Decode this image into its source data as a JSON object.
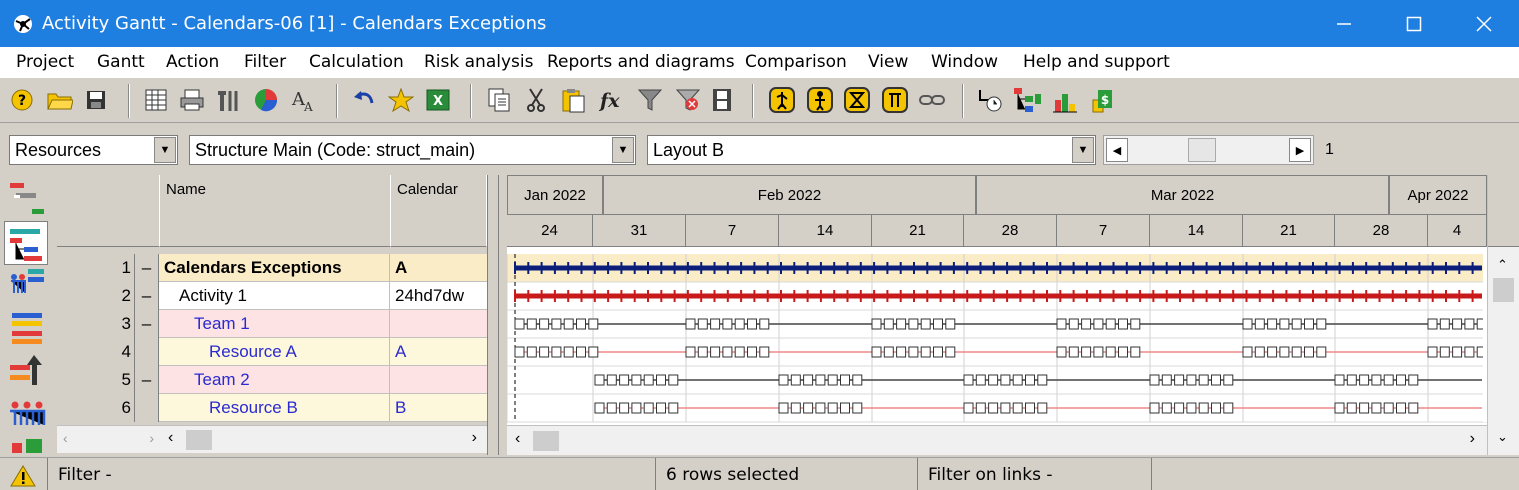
{
  "window": {
    "title": "Activity Gantt - Calendars-06 [1] - Calendars Exceptions"
  },
  "menu": [
    "Project",
    "Gantt",
    "Action",
    "Filter",
    "Calculation",
    "Risk analysis",
    "Reports and diagrams",
    "Comparison",
    "View",
    "Window",
    "Help and support"
  ],
  "toolbar": {
    "icons": [
      "help-icon",
      "open-folder-icon",
      "save-icon",
      "columns-icon",
      "print-icon",
      "tools-icon",
      "pie-chart-icon",
      "font-size-icon",
      "undo-icon",
      "favorite-star-icon",
      "excel-export-icon",
      "copy-icon",
      "cut-icon",
      "paste-icon",
      "formula-icon",
      "filter-icon",
      "clear-filter-icon",
      "film-strip-icon",
      "resource-sign-1-icon",
      "resource-sign-2-icon",
      "resource-sign-3-icon",
      "resource-sign-4-icon",
      "link-icon",
      "timer-tool-icon",
      "resource-tree-icon",
      "resource-histogram-icon",
      "cost-icon"
    ]
  },
  "selectors": {
    "view": "Resources",
    "structure": "Structure Main (Code: struct_main)",
    "layout": "Layout B",
    "page_value": "1"
  },
  "table": {
    "headers": {
      "name": "Name",
      "calendar": "Calendar"
    },
    "rows": [
      {
        "num": "1",
        "collapse": "–",
        "name": "Calendars Exceptions",
        "calendar": "A"
      },
      {
        "num": "2",
        "collapse": "–",
        "name": "Activity 1",
        "calendar": "24hd7dw"
      },
      {
        "num": "3",
        "collapse": "–",
        "name": "Team 1",
        "calendar": ""
      },
      {
        "num": "4",
        "collapse": "",
        "name": "Resource A",
        "calendar": "A"
      },
      {
        "num": "5",
        "collapse": "–",
        "name": "Team 2",
        "calendar": ""
      },
      {
        "num": "6",
        "collapse": "",
        "name": "Resource B",
        "calendar": "B"
      }
    ]
  },
  "gantt": {
    "months": [
      "Jan 2022",
      "Feb 2022",
      "Mar 2022",
      "Apr 2022"
    ],
    "weeks": [
      "24",
      "31",
      "7",
      "14",
      "21",
      "28",
      "7",
      "14",
      "21",
      "28",
      "4"
    ]
  },
  "status": {
    "filter": "Filter -",
    "selection": "6 rows selected",
    "filter_links": "Filter on links -"
  },
  "colors": {
    "title_bar": "#1f7fe0",
    "summary_bar": "#0b1e7a",
    "activity_bar": "#c81a1a",
    "team_row": "#fde3e3",
    "resource_row": "#fdf7dc",
    "summary_row": "#fbecc8"
  }
}
